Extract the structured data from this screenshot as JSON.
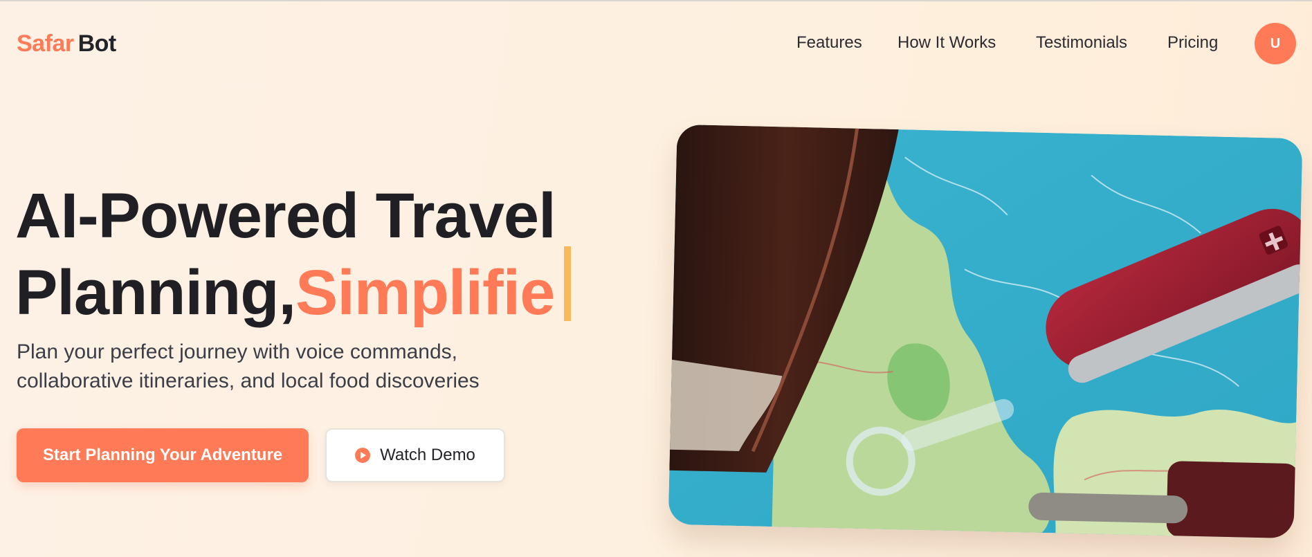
{
  "logo": {
    "part1": "Safar",
    "part2": "Bot"
  },
  "nav": {
    "items": [
      "Features",
      "How It Works",
      "Testimonials",
      "Pricing"
    ],
    "avatar": "U"
  },
  "hero": {
    "title_line1": "AI-Powered Travel",
    "title_line2_dark": "Planning,",
    "title_line2_accent": "Simplifie",
    "subtitle_line1": "Plan your perfect journey with voice commands,",
    "subtitle_line2": "collaborative itineraries, and local food discoveries",
    "primary_button": "Start Planning Your Adventure",
    "secondary_button": "Watch Demo",
    "image_alt": "Map with pocket knife and leather notebook"
  },
  "colors": {
    "accent": "#ff7a57",
    "caret": "#f9b85a",
    "text_dark": "#1f1f24",
    "background": "#fef0df"
  },
  "icons": {
    "play": "play-circle-icon"
  }
}
